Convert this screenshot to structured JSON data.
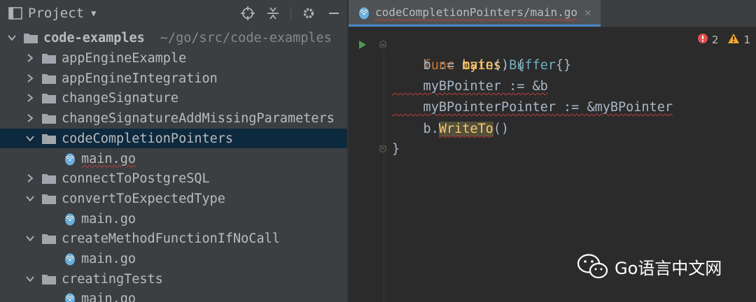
{
  "project_panel": {
    "title": "Project",
    "tree": [
      {
        "name": "code-examples",
        "path": "~/go/src/code-examples",
        "kind": "folder",
        "level": 0,
        "expanded": true
      },
      {
        "name": "appEngineExample",
        "kind": "folder",
        "level": 1,
        "expanded": false
      },
      {
        "name": "appEngineIntegration",
        "kind": "folder",
        "level": 1,
        "expanded": false
      },
      {
        "name": "changeSignature",
        "kind": "folder",
        "level": 1,
        "expanded": false
      },
      {
        "name": "changeSignatureAddMissingParameters",
        "kind": "folder",
        "level": 1,
        "expanded": false
      },
      {
        "name": "codeCompletionPointers",
        "kind": "folder",
        "level": 1,
        "expanded": true,
        "selected": true
      },
      {
        "name": "main.go",
        "kind": "file",
        "level": 2
      },
      {
        "name": "connectToPostgreSQL",
        "kind": "folder",
        "level": 1,
        "expanded": false
      },
      {
        "name": "convertToExpectedType",
        "kind": "folder",
        "level": 1,
        "expanded": true
      },
      {
        "name": "main.go",
        "kind": "file",
        "level": 2
      },
      {
        "name": "createMethodFunctionIfNoCall",
        "kind": "folder",
        "level": 1,
        "expanded": true
      },
      {
        "name": "main.go",
        "kind": "file",
        "level": 2
      },
      {
        "name": "creatingTests",
        "kind": "folder",
        "level": 1,
        "expanded": true
      },
      {
        "name": "main.go",
        "kind": "file",
        "level": 2
      }
    ]
  },
  "editor": {
    "tab_label": "codeCompletionPointers/main.go",
    "code": {
      "l1_kw": "func",
      "l1_name": "main",
      "l1_rest": "() {",
      "l2_pre": "    b := ",
      "l2_pkg": "bytes",
      "l2_dot": ".",
      "l2_type": "Buffer",
      "l2_post": "{}",
      "l3": "    myBPointer := &b",
      "l4": "    myBPointerPointer := &myBPointer",
      "l5_pre": "    b.",
      "l5_fn": "WriteTo",
      "l5_post": "()",
      "l6": "}"
    },
    "errors_count": "2",
    "warnings_count": "1"
  },
  "watermark": {
    "text": "Go语言中文网"
  },
  "colors": {
    "panel_bg": "#3c3f41",
    "editor_bg": "#2b2b2b",
    "selection": "#0d293e",
    "keyword": "#cc7832",
    "function": "#ffc66d",
    "error": "#e0504d",
    "warning": "#f0a732",
    "tab_accent": "#4a88c7"
  },
  "icons": [
    "window-icon",
    "dropdown-arrow-icon",
    "locate-icon",
    "collapse-all-icon",
    "gear-icon",
    "minimize-icon",
    "folder-icon",
    "go-file-icon",
    "run-icon",
    "error-icon",
    "warning-icon",
    "wechat-icon"
  ]
}
